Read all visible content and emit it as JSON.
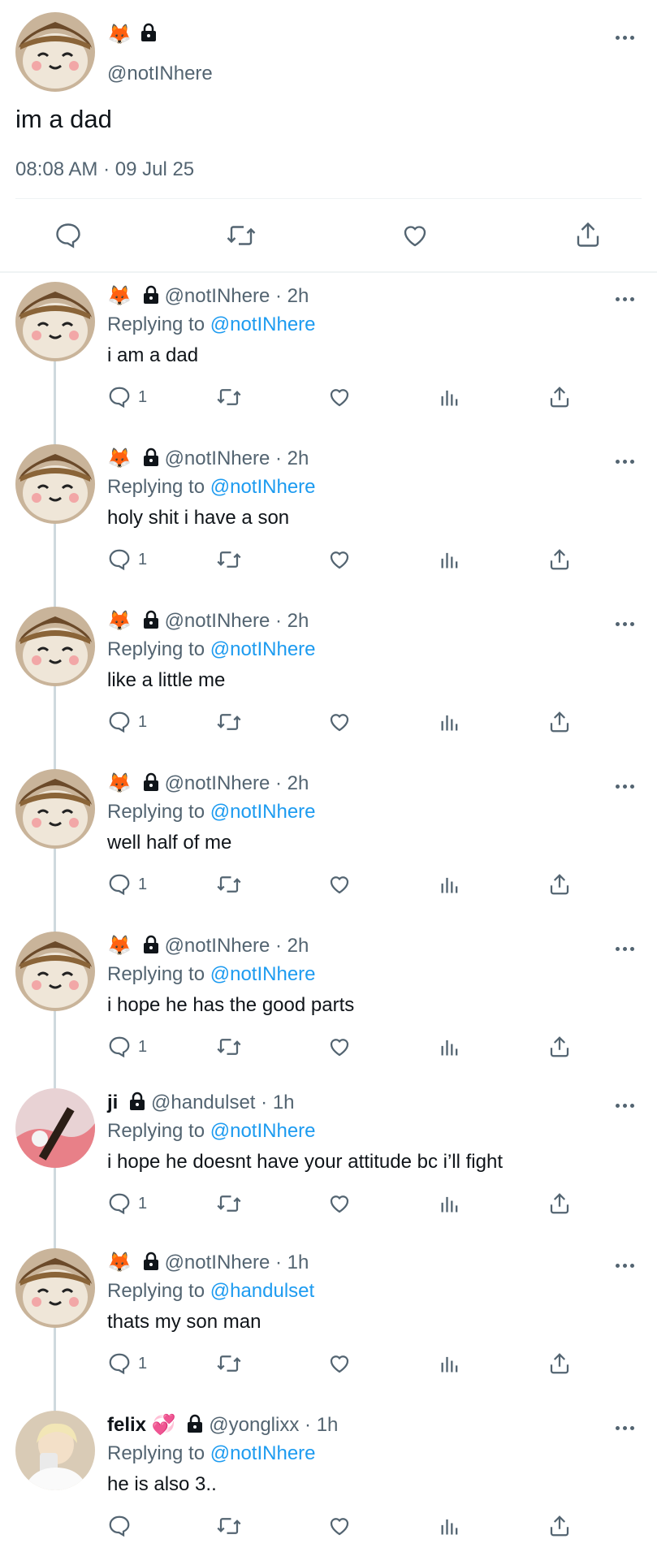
{
  "main_tweet": {
    "handle": "@notINhere",
    "text": "im a dad",
    "timestamp": "08:08 AM · 09 Jul 25",
    "icons": [
      "fox-emoji",
      "lock-icon"
    ],
    "actions": [
      "reply-icon",
      "retweet-icon",
      "like-icon",
      "share-icon"
    ]
  },
  "replies": [
    {
      "name": "",
      "handle": "@notINhere",
      "time": "2h",
      "replying_to": "@notINhere",
      "text": "i am a dad",
      "reply_count": "1"
    },
    {
      "name": "",
      "handle": "@notINhere",
      "time": "2h",
      "replying_to": "@notINhere",
      "text": "holy shit i have a son",
      "reply_count": "1"
    },
    {
      "name": "",
      "handle": "@notINhere",
      "time": "2h",
      "replying_to": "@notINhere",
      "text": "like a little me",
      "reply_count": "1"
    },
    {
      "name": "",
      "handle": "@notINhere",
      "time": "2h",
      "replying_to": "@notINhere",
      "text": "well half of me",
      "reply_count": "1"
    },
    {
      "name": "",
      "handle": "@notINhere",
      "time": "2h",
      "replying_to": "@notINhere",
      "text": "i hope he has the good parts",
      "reply_count": "1"
    },
    {
      "name": "ji",
      "handle": "@handulset",
      "time": "1h",
      "replying_to": "@notINhere",
      "text": "i hope he doesnt have your attitude bc i’ll fight",
      "reply_count": "1"
    },
    {
      "name": "",
      "handle": "@notINhere",
      "time": "1h",
      "replying_to": "@handulset",
      "text": "thats my son man",
      "reply_count": "1"
    },
    {
      "name": "felix",
      "handle": "@yonglixx",
      "time": "1h",
      "replying_to": "@notINhere",
      "text": "he is also 3..",
      "reply_count": ""
    }
  ],
  "labels": {
    "replying_prefix": "Replying to",
    "dot": "·"
  },
  "colors": {
    "accent": "#1d9bf0",
    "muted": "#536471",
    "divider": "#eff3f4",
    "thread_line": "#cfd9de"
  }
}
